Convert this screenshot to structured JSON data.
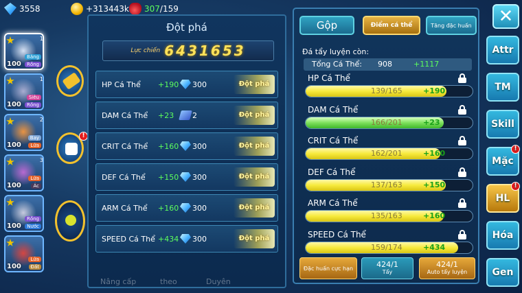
{
  "topbar": {
    "diamonds": "3558",
    "gold": "+313443k",
    "potion_current": "307",
    "potion_max": "/159"
  },
  "roster": [
    {
      "level": "100",
      "tag1": "Băng",
      "tag2": "Rồng",
      "num": "1",
      "tag1_color": "#2b9fd6",
      "tag2_color": "#7a4fd0"
    },
    {
      "level": "100",
      "tag1": "Siêu",
      "tag2": "Rồng",
      "num": "1",
      "tag1_color": "#d1449a",
      "tag2_color": "#7a4fd0"
    },
    {
      "level": "100",
      "tag1": "Bay",
      "tag2": "Lửa",
      "num": "2",
      "tag1_color": "#7fa7d8",
      "tag2_color": "#e4632a"
    },
    {
      "level": "100",
      "tag1": "Lửa",
      "tag2": "Ác",
      "num": "3",
      "tag1_color": "#e4632a",
      "tag2_color": "#4a3a5a"
    },
    {
      "level": "100",
      "tag1": "Rồng",
      "tag2": "Nước",
      "num": "",
      "tag1_color": "#7a4fd0",
      "tag2_color": "#2e7ad9"
    },
    {
      "level": "100",
      "tag1": "Lửa",
      "tag2": "Đất",
      "num": "",
      "tag1_color": "#e4632a",
      "tag2_color": "#b98a3c"
    }
  ],
  "left_panel": {
    "title": "Đột phá",
    "power_label": "Lực chiến",
    "power_value": "6431653",
    "rows": [
      {
        "name": "HP Cá Thể",
        "bonus": "+190",
        "icon": "diamond-icon",
        "cost": "300",
        "button": "Đột phá"
      },
      {
        "name": "DAM Cá Thể",
        "bonus": "+23",
        "icon": "scroll-icon",
        "cost": "2",
        "button": "Đột phá"
      },
      {
        "name": "CRIT Cá Thể",
        "bonus": "+160",
        "icon": "diamond-icon",
        "cost": "300",
        "button": "Đột phá"
      },
      {
        "name": "DEF Cá Thể",
        "bonus": "+150",
        "icon": "diamond-icon",
        "cost": "300",
        "button": "Đột phá"
      },
      {
        "name": "ARM Cá Thể",
        "bonus": "+160",
        "icon": "diamond-icon",
        "cost": "300",
        "button": "Đột phá"
      },
      {
        "name": "SPEED Cá Thể",
        "bonus": "+434",
        "icon": "diamond-icon",
        "cost": "300",
        "button": "Đột phá"
      }
    ],
    "bottom_tabs": [
      "Nâng cấp",
      "theo",
      "Duyên"
    ]
  },
  "right_panel": {
    "tabs": {
      "merge": "Gộp",
      "points": "Điểm cá thể",
      "boost": "Tăng đặc huấn"
    },
    "remaining_label": "Đá tẩy luyện còn:",
    "total_label": "Tổng Cá Thể:",
    "total_value": "908",
    "total_bonus": "+1117",
    "stats": [
      {
        "name": "HP Cá Thể",
        "value": "139/165",
        "bonus": "+190",
        "progress": 0.842,
        "color": "yellow"
      },
      {
        "name": "DAM Cá Thể",
        "value": "166/201",
        "bonus": "+23",
        "progress": 0.826,
        "color": "green"
      },
      {
        "name": "CRIT Cá Thể",
        "value": "162/201",
        "bonus": "+160",
        "progress": 0.806,
        "color": "yellow"
      },
      {
        "name": "DEF Cá Thể",
        "value": "137/163",
        "bonus": "+150",
        "progress": 0.84,
        "color": "yellow"
      },
      {
        "name": "ARM Cá Thể",
        "value": "135/163",
        "bonus": "+160",
        "progress": 0.828,
        "color": "yellow"
      },
      {
        "name": "SPEED Cá Thể",
        "value": "159/174",
        "bonus": "+434",
        "progress": 0.914,
        "color": "yellow"
      }
    ],
    "bottom_buttons": {
      "special_training": "Đặc huấn cực hạn",
      "wash_count": "424/1",
      "wash_label": "Tẩy",
      "auto_count": "424/1",
      "auto_label": "Auto tẩy luyện"
    }
  },
  "menu": {
    "close": "✕",
    "items": [
      "Attr",
      "TM",
      "Skill",
      "Mặc",
      "HL",
      "Hóa",
      "Gen"
    ],
    "badges": [
      "",
      "",
      "",
      "!",
      "!",
      "",
      ""
    ]
  }
}
